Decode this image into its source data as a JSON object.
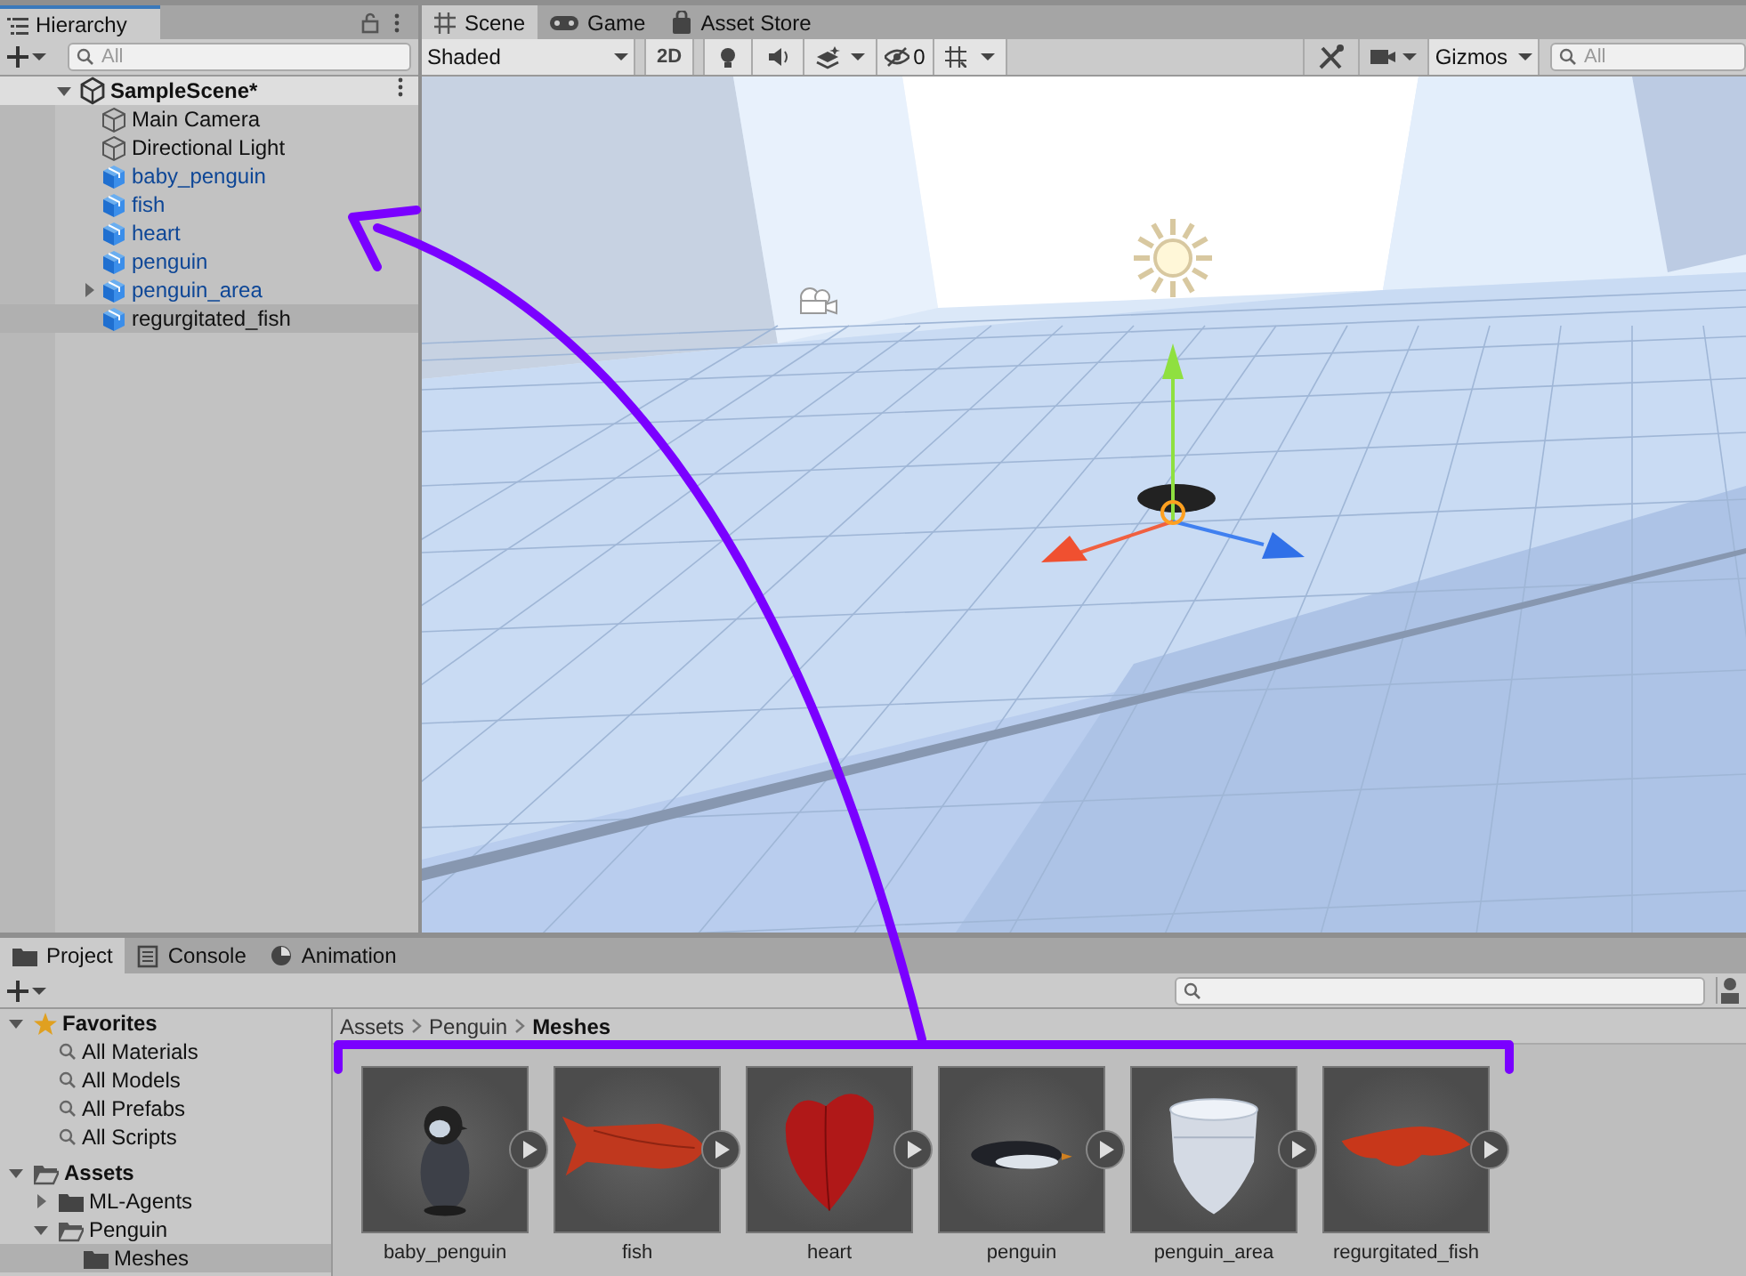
{
  "hierarchy": {
    "tab": "Hierarchy",
    "search": {
      "placeholder": "All"
    },
    "scene": {
      "name": "SampleScene*",
      "expanded": true,
      "children": [
        {
          "name": "Main Camera",
          "kind": "object",
          "selected": false
        },
        {
          "name": "Directional Light",
          "kind": "object",
          "selected": false
        },
        {
          "name": "baby_penguin",
          "kind": "prefab",
          "selected": false
        },
        {
          "name": "fish",
          "kind": "prefab",
          "selected": false
        },
        {
          "name": "heart",
          "kind": "prefab",
          "selected": false
        },
        {
          "name": "penguin",
          "kind": "prefab",
          "selected": false
        },
        {
          "name": "penguin_area",
          "kind": "prefab",
          "selected": false,
          "expanded": false
        },
        {
          "name": "regurgitated_fish",
          "kind": "prefab",
          "selected": true
        }
      ]
    }
  },
  "scene_view": {
    "tabs": [
      {
        "label": "Scene",
        "kind": "scene",
        "selected": true
      },
      {
        "label": "Game",
        "kind": "game",
        "selected": false
      },
      {
        "label": "Asset Store",
        "kind": "store",
        "selected": false
      }
    ],
    "toolbar": {
      "lighting_on": false,
      "audio_on": false,
      "shading": "Shaded",
      "mode_2d": "2D",
      "hidden_count": "0",
      "gizmos": "Gizmos",
      "search": {
        "placeholder": "All"
      }
    }
  },
  "project": {
    "tabs": [
      {
        "label": "Project",
        "kind": "folder",
        "selected": true
      },
      {
        "label": "Console",
        "kind": "console",
        "selected": false
      },
      {
        "label": "Animation",
        "kind": "clock",
        "selected": false
      }
    ],
    "tree": [
      {
        "name": "Favorites",
        "kind": "favorites",
        "expanded": true,
        "selected": false,
        "children": [
          {
            "name": "All Materials",
            "kind": "search",
            "selected": false
          },
          {
            "name": "All Models",
            "kind": "search",
            "selected": false
          },
          {
            "name": "All Prefabs",
            "kind": "search",
            "selected": false
          },
          {
            "name": "All Scripts",
            "kind": "search",
            "selected": false
          }
        ]
      },
      {
        "name": "Assets",
        "kind": "root",
        "expanded": true,
        "selected": false,
        "children": [
          {
            "name": "ML-Agents",
            "kind": "folder",
            "expanded": false,
            "selected": false
          },
          {
            "name": "Penguin",
            "kind": "folder",
            "expanded": true,
            "selected": false,
            "children": [
              {
                "name": "Meshes",
                "kind": "folder",
                "selected": true
              }
            ]
          }
        ]
      }
    ],
    "breadcrumb": [
      "Assets",
      "Penguin",
      "Meshes"
    ],
    "assets": [
      {
        "name": "baby_penguin"
      },
      {
        "name": "fish"
      },
      {
        "name": "heart"
      },
      {
        "name": "penguin"
      },
      {
        "name": "penguin_area"
      },
      {
        "name": "regurgitated_fish"
      }
    ]
  }
}
